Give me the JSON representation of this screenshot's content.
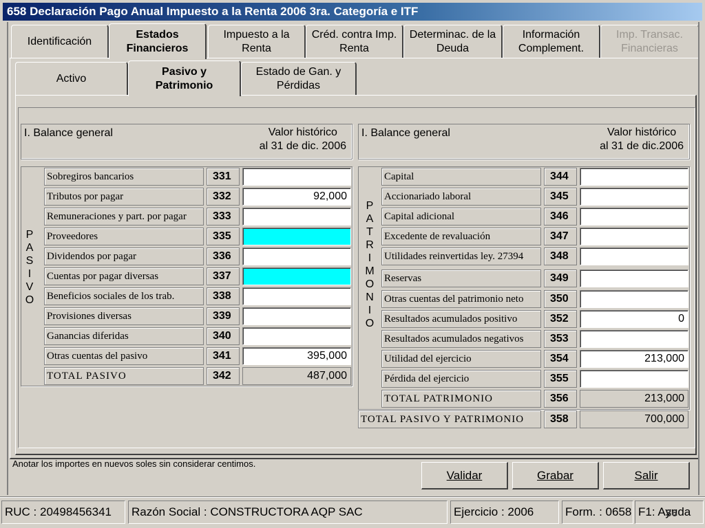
{
  "window": {
    "title": "658 Declaración Pago Anual Impuesto a la Renta 2006 3ra. Categoría e ITF"
  },
  "main_tabs": [
    {
      "line1": "Identificación",
      "line2": ""
    },
    {
      "line1": "Estados",
      "line2": "Financieros"
    },
    {
      "line1": "Impuesto a  la",
      "line2": "Renta"
    },
    {
      "line1": "Créd. contra Imp.",
      "line2": "Renta"
    },
    {
      "line1": "Determinac. de la",
      "line2": "Deuda"
    },
    {
      "line1": "Información",
      "line2": "Complement."
    },
    {
      "line1": "Imp. Transac.",
      "line2": "Financieras"
    }
  ],
  "sub_tabs": [
    {
      "line1": "Activo",
      "line2": ""
    },
    {
      "line1": "Pasivo y",
      "line2": "Patrimonio"
    },
    {
      "line1": "Estado de Gan. y",
      "line2": "Pérdidas"
    }
  ],
  "left_header": {
    "title": "I. Balance general",
    "col1": "Valor histórico",
    "col2": "al 31 de dic. 2006"
  },
  "right_header": {
    "title": "I. Balance general",
    "col1": "Valor histórico",
    "col2": "al 31 de dic.2006"
  },
  "pasivo_label": "P\nA\nS\nI\nV\nO",
  "patrimonio_label": "P\nA\nT\nR\nI\nM\nO\nN\nI\nO",
  "pasivo_rows": [
    {
      "label": "Sobregiros bancarios",
      "code": "331",
      "value": ""
    },
    {
      "label": "Tributos por pagar",
      "code": "332",
      "value": "92,000"
    },
    {
      "label": "Remuneraciones y part. por pagar",
      "code": "333",
      "value": ""
    },
    {
      "label": "Proveedores",
      "code": "335",
      "value": ""
    },
    {
      "label": "Dividendos por pagar",
      "code": "336",
      "value": ""
    },
    {
      "label": "Cuentas por pagar diversas",
      "code": "337",
      "value": ""
    },
    {
      "label": "Beneficios sociales de los trab.",
      "code": "338",
      "value": ""
    },
    {
      "label": "Provisiones diversas",
      "code": "339",
      "value": ""
    },
    {
      "label": "Ganancias diferidas",
      "code": "340",
      "value": ""
    },
    {
      "label": "Otras cuentas del pasivo",
      "code": "341",
      "value": "395,000"
    }
  ],
  "pasivo_total": {
    "label": "TOTAL PASIVO",
    "code": "342",
    "value": "487,000"
  },
  "patrimonio_rows": [
    {
      "label": "Capital",
      "code": "344",
      "value": ""
    },
    {
      "label": "Accionariado laboral",
      "code": "345",
      "value": ""
    },
    {
      "label": "Capital adicional",
      "code": "346",
      "value": ""
    },
    {
      "label": "Excedente de revaluación",
      "code": "347",
      "value": ""
    },
    {
      "label": "Utilidades reinvertidas ley. 27394",
      "code": "348",
      "value": ""
    },
    {
      "label": "Reservas",
      "code": "349",
      "value": ""
    },
    {
      "label": "Otras cuentas del patrimonio neto",
      "code": "350",
      "value": ""
    },
    {
      "label": "Resultados acumulados positivo",
      "code": "352",
      "value": "0"
    },
    {
      "label": "Resultados acumulados negativos",
      "code": "353",
      "value": ""
    },
    {
      "label": "Utilidad del ejercicio",
      "code": "354",
      "value": "213,000"
    },
    {
      "label": "Pérdida del ejercicio",
      "code": "355",
      "value": ""
    }
  ],
  "patrimonio_total": {
    "label": "TOTAL PATRIMONIO",
    "code": "356",
    "value": "213,000"
  },
  "grand_total": {
    "label": "TOTAL PASIVO Y PATRIMONIO",
    "code": "358",
    "value": "700,000"
  },
  "note": "Anotar los importes en nuevos soles sin considerar centimos.",
  "buttons": {
    "validar": "Validar",
    "grabar": "Grabar",
    "salir": "Salir"
  },
  "status": {
    "ruc": "RUC : 20498456341",
    "razon": "Razón Social : CONSTRUCTORA AQP SAC",
    "ejercicio": "Ejercicio : 2006",
    "form": "Form. : 0658",
    "help": "F1: Ayuda",
    "page": "36"
  },
  "colors": {
    "highlight": "#00ffff",
    "title_bar": "#0a246a"
  }
}
